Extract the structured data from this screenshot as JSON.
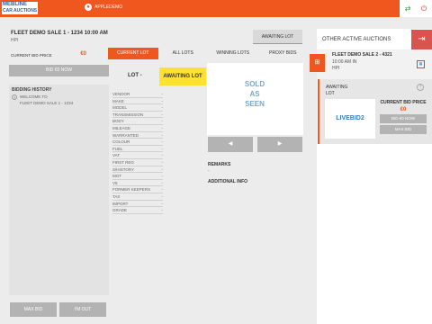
{
  "header": {
    "logo_line1": "MEBLINE",
    "logo_line2": "CAR AUCTIONS",
    "username": "APPLEDEMO"
  },
  "sale": {
    "title": "FLEET DEMO SALE 1 - 1234 10:00 AM",
    "subtitle": "HPI",
    "status": "AWAITING LOT"
  },
  "bidding": {
    "current_bid_price_label": "CURRENT BID PRICE",
    "current_bid_price": "€0",
    "bid_now_label": "BID €0 NOW",
    "history_title": "BIDDING HISTORY",
    "history_line1": "WELCOME TO",
    "history_line2": "FLEET DEMO SALE 1 - 1234"
  },
  "bottom_buttons": {
    "max_bid": "MAX BID",
    "im_out": "I'M OUT"
  },
  "tabs": [
    "CURRENT LOT",
    "ALL LOTS",
    "WINNING LOTS",
    "PROXY BIDS"
  ],
  "lot": {
    "label": "LOT -",
    "status": "AWAITING LOT",
    "fields": [
      {
        "label": "VENDOR",
        "value": "-"
      },
      {
        "label": "MAKE",
        "value": "-"
      },
      {
        "label": "MODEL",
        "value": "-"
      },
      {
        "label": "TRANSMISSION",
        "value": "-"
      },
      {
        "label": "BODY",
        "value": "-"
      },
      {
        "label": "MILEAGE",
        "value": "-"
      },
      {
        "label": "WARRANTED",
        "value": "-"
      },
      {
        "label": "COLOUR",
        "value": "-"
      },
      {
        "label": "FUEL",
        "value": "-"
      },
      {
        "label": "VAT",
        "value": "-"
      },
      {
        "label": "FIRST REG",
        "value": "-"
      },
      {
        "label": "S/HISTORY",
        "value": "-"
      },
      {
        "label": "MOT",
        "value": "-"
      },
      {
        "label": "V5",
        "value": "-"
      },
      {
        "label": "FORMER KEEPERS",
        "value": "-"
      },
      {
        "label": "TAX",
        "value": "-"
      },
      {
        "label": "IMPORT",
        "value": "-"
      },
      {
        "label": "GRADE",
        "value": "-"
      }
    ],
    "sold_text_1": "SOLD",
    "sold_text_2": "AS",
    "sold_text_3": "SEEN",
    "remarks_title": "REMARKS",
    "remarks_value": "-",
    "additional_info_title": "ADDITIONAL INFO"
  },
  "other_auctions": {
    "title": "OTHER ACTIVE AUCTIONS",
    "card": {
      "title": "FLEET DEMO SALE 2 - 4321",
      "time": "10:00 AM IN",
      "type": "HPI"
    },
    "live": {
      "status_1": "AWAITING",
      "status_2": "LOT",
      "logo_text": "LIVEBID2",
      "current_bid_price_label": "CURRENT BID PRICE",
      "current_bid_price": "€0",
      "bid_now_label": "BID €0 NOW",
      "max_bid_label": "MAX BID"
    }
  }
}
